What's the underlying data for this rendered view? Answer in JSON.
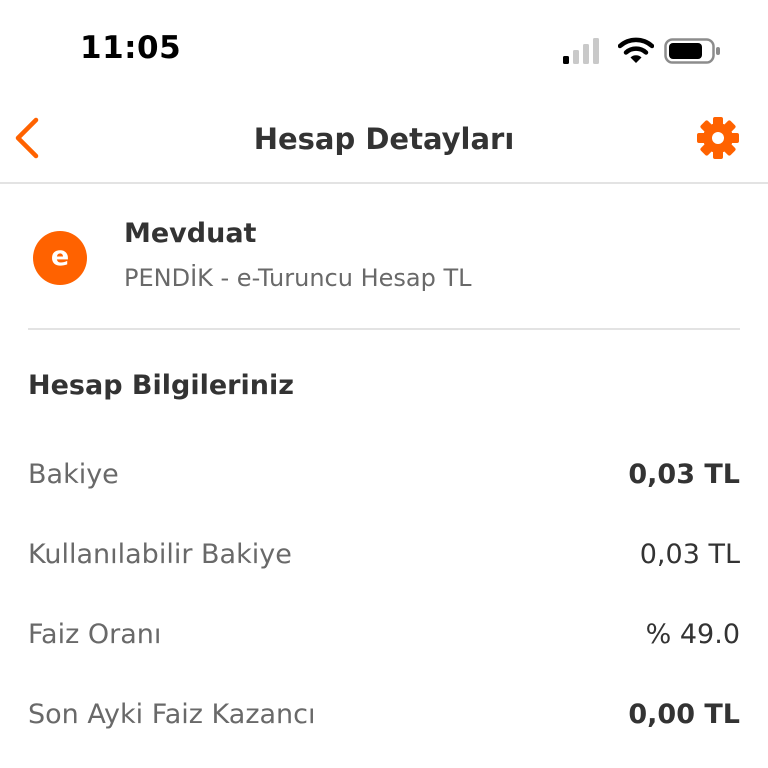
{
  "status_bar": {
    "time": "11:05",
    "icons": [
      "cellular-signal-icon",
      "wifi-icon",
      "battery-icon"
    ]
  },
  "header": {
    "title": "Hesap Detayları",
    "back_icon": "chevron-left-icon",
    "settings_icon": "gear-icon"
  },
  "account": {
    "avatar_letter": "e",
    "name": "Mevduat",
    "subtitle": "PENDİK - e-Turuncu Hesap TL"
  },
  "section": {
    "title": "Hesap Bilgileriniz"
  },
  "info_rows": [
    {
      "label": "Bakiye",
      "value": "0,03 TL"
    },
    {
      "label": "Kullanılabilir Bakiye",
      "value": "0,03 TL"
    },
    {
      "label": "Faiz Oranı",
      "value": "% 49.0"
    },
    {
      "label": "Son Ayki Faiz Kazancı",
      "value": "0,00 TL"
    }
  ],
  "colors": {
    "accent": "#ff6200",
    "text_primary": "#333333",
    "text_secondary": "#696969",
    "divider": "#e3e3e3"
  }
}
